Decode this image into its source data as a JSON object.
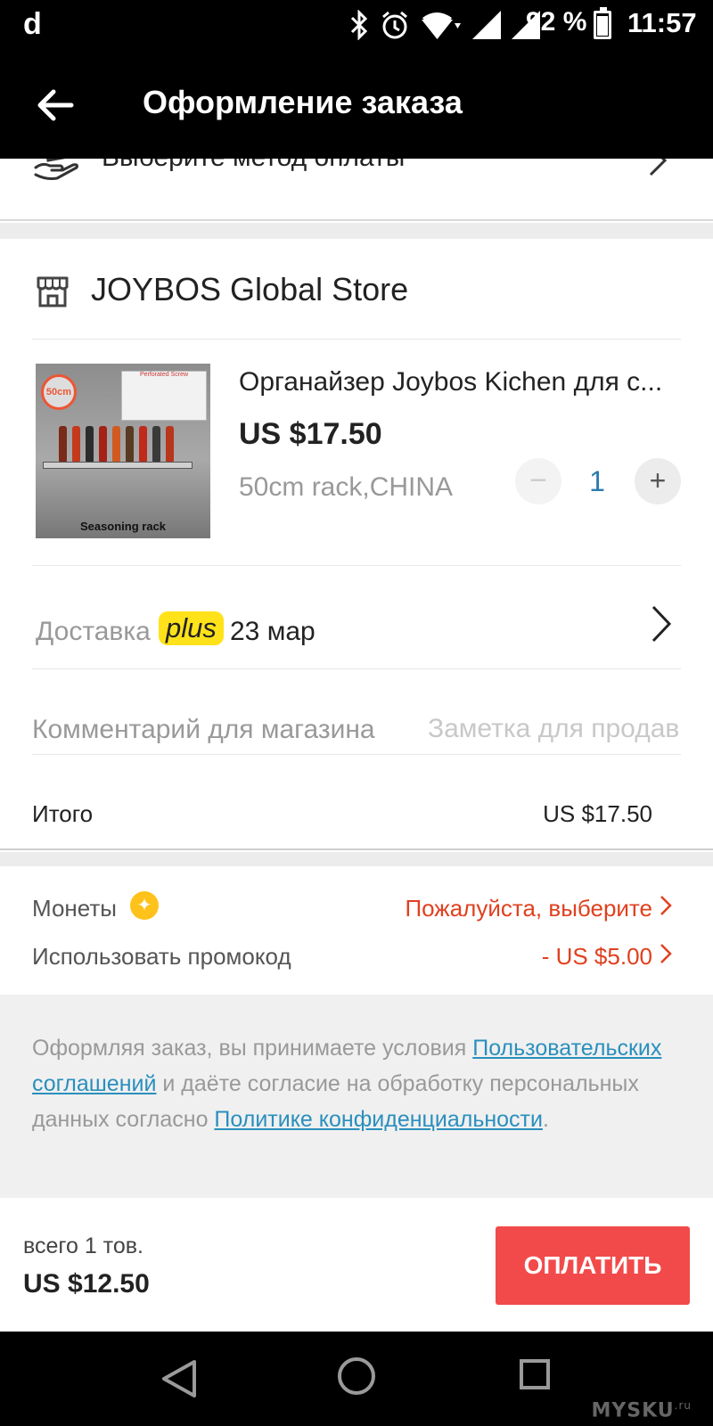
{
  "status_bar": {
    "logo": "d",
    "battery_percent": "92 %",
    "battery_level": 0.92,
    "time": "11:57",
    "icons": [
      "bluetooth-icon",
      "alarm-icon",
      "wifi-icon",
      "signal-icon",
      "signal-icon"
    ]
  },
  "app_bar": {
    "back_icon": "arrow-left-icon",
    "title": "Оформление заказа"
  },
  "payment": {
    "label": "Выберите метод оплаты",
    "icon": "hand-coins-icon"
  },
  "store": {
    "name": "JOYBOS Global Store",
    "icon": "store-icon"
  },
  "product": {
    "title": "Органайзер Joybos Kichen для с...",
    "price": "US $17.50",
    "variant": "50cm rack,CHINA",
    "quantity": "1",
    "minus_label": "−",
    "plus_label": "+",
    "image": {
      "badge": "50cm",
      "caption": "Seasoning rack",
      "insert_label": "Perforated Screw"
    }
  },
  "delivery": {
    "label": "Доставка",
    "badge": "plus",
    "date": "23 мар"
  },
  "comment": {
    "label": "Комментарий для магазина",
    "placeholder": "Заметка для продавца"
  },
  "subtotal": {
    "label": "Итого",
    "value": "US $17.50"
  },
  "coins": {
    "label": "Монеты",
    "value": "Пожалуйста, выберите"
  },
  "promo": {
    "label": "Использовать промокод",
    "value": "- US $5.00"
  },
  "terms": {
    "part1": "Оформляя заказ, вы принимаете условия ",
    "link1": "Пользовательских соглашений",
    "part2": " и даёте согласие на обработку персональных данных согласно ",
    "link2": "Политике конфиденциальности",
    "part3": "."
  },
  "checkout": {
    "count": "всего 1 тов.",
    "total": "US $12.50",
    "pay_button": "ОПЛАТИТЬ"
  },
  "watermark": {
    "text": "MYSKU",
    "suffix": ".ru"
  },
  "colors": {
    "accent_red": "#f24a4a",
    "link_blue": "#2a8fbd",
    "plus_yellow": "#ffe21a",
    "coin_gold": "#ffc21a",
    "price_red": "#e0401f"
  }
}
